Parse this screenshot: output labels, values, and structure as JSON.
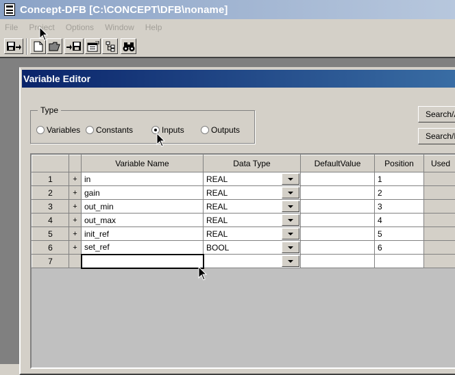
{
  "app": {
    "title": "Concept-DFB [C:\\CONCEPT\\DFB\\noname]"
  },
  "menu": {
    "items": [
      "File",
      "Project",
      "Options",
      "Window",
      "Help"
    ]
  },
  "toolbar": {
    "icons": [
      "save-transfer-icon",
      "new-file-icon",
      "open-folder-icon",
      "save-download-icon",
      "properties-icon",
      "structure-icon",
      "find-binoculars-icon"
    ]
  },
  "editor": {
    "title": "Variable Editor",
    "type_group": {
      "label": "Type",
      "options": [
        "Variables",
        "Constants",
        "Inputs",
        "Outputs"
      ],
      "selected": "Inputs"
    },
    "buttons": {
      "search_a": "Search/A",
      "search_f": "Search/F"
    },
    "grid": {
      "headers": [
        "Variable Name",
        "Data Type",
        "DefaultValue",
        "Position",
        "Used"
      ],
      "rows": [
        {
          "num": "1",
          "expander": "+",
          "name": "in",
          "type": "REAL",
          "default": "",
          "position": "1"
        },
        {
          "num": "2",
          "expander": "+",
          "name": "gain",
          "type": "REAL",
          "default": "",
          "position": "2"
        },
        {
          "num": "3",
          "expander": "+",
          "name": "out_min",
          "type": "REAL",
          "default": "",
          "position": "3"
        },
        {
          "num": "4",
          "expander": "+",
          "name": "out_max",
          "type": "REAL",
          "default": "",
          "position": "4"
        },
        {
          "num": "5",
          "expander": "+",
          "name": "init_ref",
          "type": "REAL",
          "default": "",
          "position": "5"
        },
        {
          "num": "6",
          "expander": "+",
          "name": "set_ref",
          "type": "BOOL",
          "default": "",
          "position": "6"
        },
        {
          "num": "7",
          "expander": "",
          "name": "",
          "type": "",
          "default": "",
          "position": ""
        }
      ]
    }
  }
}
